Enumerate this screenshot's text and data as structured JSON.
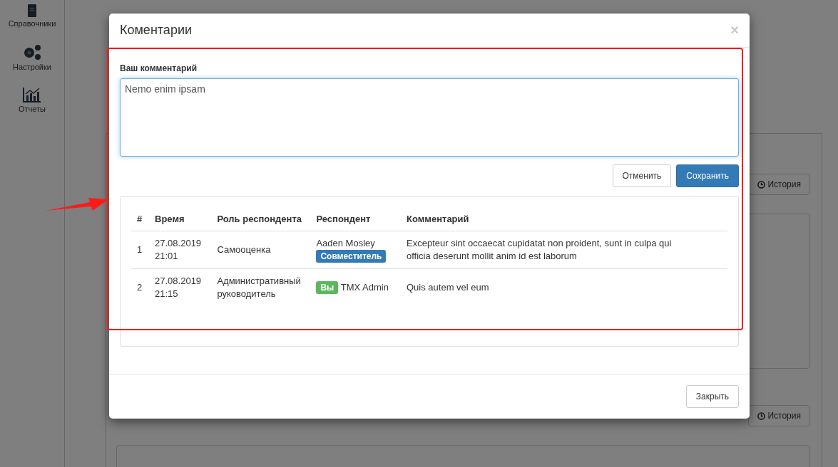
{
  "sidebar": {
    "items": [
      {
        "label": "Справочники"
      },
      {
        "label": "Настройки"
      },
      {
        "label": "Отчеты"
      }
    ]
  },
  "background": {
    "history_buttons": [
      "История",
      "История"
    ]
  },
  "modal": {
    "title": "Коментарии",
    "close": "×",
    "form": {
      "label": "Ваш комментарий",
      "value": "Nemo enim ipsam",
      "buttons": [
        {
          "label": "Отменить",
          "kind": "default"
        },
        {
          "label": "Сохранить",
          "kind": "primary"
        }
      ]
    },
    "table": {
      "columns": [
        "#",
        "Время",
        "Роль респондента",
        "Респондент",
        "Комментарий"
      ],
      "rows": [
        {
          "cells": [
            "1",
            "27.08.2019\n21:01",
            "Самооценка"
          ],
          "respondent": {
            "kind": "stacked",
            "name": "Aaden Mosley",
            "badge": {
              "label": "Совместитель",
              "color": "#337ab7"
            }
          },
          "comment": "Excepteur sint occaecat cupidatat non proident, sunt in culpa qui officia deserunt mollit anim id est laborum"
        },
        {
          "cells": [
            "2",
            "27.08.2019\n21:15",
            "Административный руководитель"
          ],
          "respondent": {
            "kind": "inline",
            "name": "TMX Admin",
            "badge": {
              "label": "Вы",
              "color": "#5cb85c"
            }
          },
          "comment": "Quis autem vel eum"
        }
      ]
    },
    "footer_button": "Закрыть"
  },
  "annotation": {
    "highlight": true,
    "arrow": true
  }
}
